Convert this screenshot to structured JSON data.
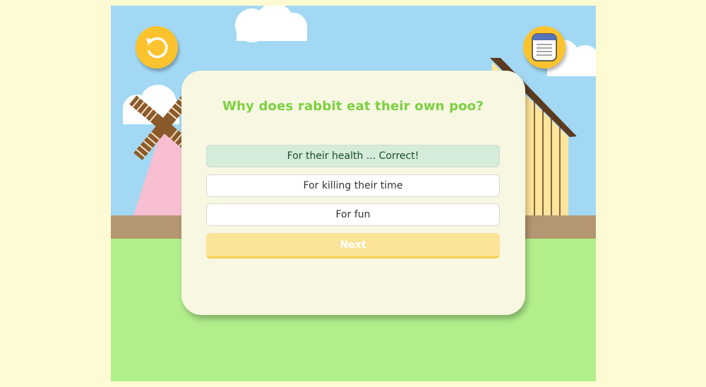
{
  "scene": {
    "restart_icon": "restart-icon",
    "notes_icon": "notepad-icon",
    "colors": {
      "sky": "#a2d8f3",
      "grass": "#b1ef8b",
      "fence": "#b49670",
      "page_bg": "#fefbd4",
      "button_yellow": "#fcc32e"
    }
  },
  "quiz": {
    "question": "Why does rabbit eat their own poo?",
    "answers": [
      {
        "label": "For their health ... Correct!",
        "state": "correct"
      },
      {
        "label": "For killing their time",
        "state": "default"
      },
      {
        "label": "For fun",
        "state": "default"
      }
    ],
    "next_label": "Next",
    "colors": {
      "question": "#7ad13f",
      "correct_bg": "#d5ecda",
      "next_bg": "#fbe498"
    }
  }
}
